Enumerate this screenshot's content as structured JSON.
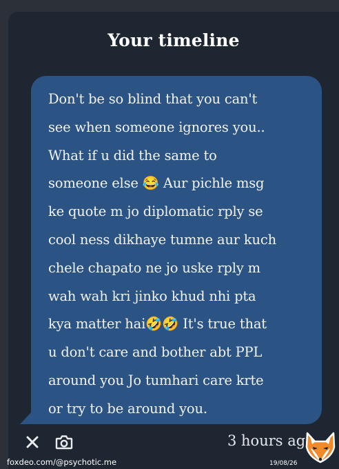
{
  "header": {
    "title": "Your timeline"
  },
  "message": {
    "text": "Don't be so blind that you can't\nsee when someone ignores you..\nWhat if u did the same to\nsomeone else 😂 Aur pichle msg\nke quote m jo diplomatic rply se\ncool ness dikhaye tumne aur kuch\nchele chapato ne jo uske rply m\nwah wah kri jinko khud nhi pta\nkya matter hai🤣🤣 It's true that\nu don't care and bother abt PPL\naround you Jo tumhari care krte\nor try to be around you.",
    "bubble_color": "#2b5384"
  },
  "footer": {
    "close_icon": "close-icon",
    "camera_icon": "camera-icon",
    "timestamp": "3 hours ag"
  },
  "watermark": {
    "url": "foxdeo.com/@psychotic.me",
    "date": "19/08/26",
    "logo": "fox-logo"
  },
  "colors": {
    "background": "#2c3038",
    "card": "#1e2631",
    "text": "#ffffff"
  }
}
